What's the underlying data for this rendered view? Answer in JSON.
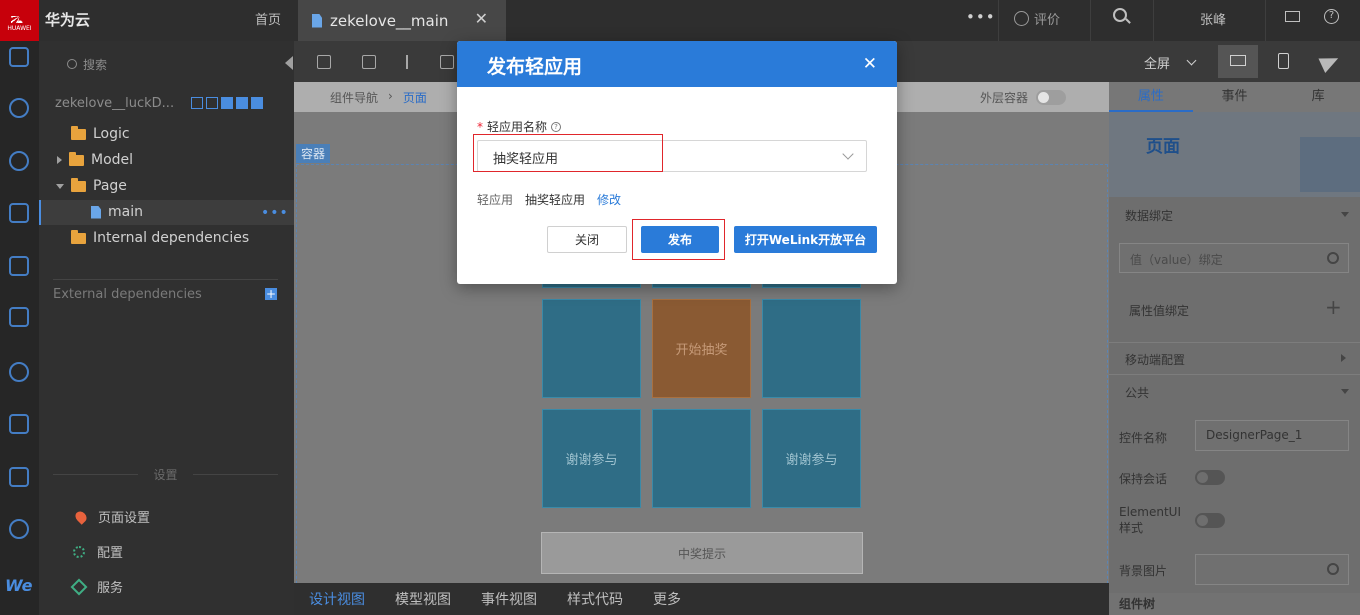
{
  "topbar": {
    "logo_text": "HUAWEI",
    "brand": "华为云",
    "home": "首页",
    "tab_title": "zekelove__main",
    "tab_close": "✕",
    "more": "•••",
    "rate": "评价",
    "user": "张峰",
    "help": "?"
  },
  "left_panel": {
    "search_placeholder": "搜索",
    "project_name": "zekelove__luckD...",
    "tree": [
      {
        "label": "Logic"
      },
      {
        "label": "Model"
      },
      {
        "label": "Page"
      },
      {
        "label": "main"
      },
      {
        "label": "Internal dependencies"
      }
    ],
    "row_menu": "•••",
    "external_dependencies": "External dependencies",
    "add": "+",
    "settings_title": "设置",
    "settings": [
      {
        "label": "页面设置"
      },
      {
        "label": "配置"
      },
      {
        "label": "服务"
      }
    ],
    "rail_we": "We"
  },
  "toolbar": {
    "fullscreen": "全屏"
  },
  "canvas": {
    "breadcrumb": [
      "组件导航",
      "›",
      "页面"
    ],
    "outer_container": "外层容器",
    "container_tag": "容器",
    "cells": [
      {
        "label": ""
      },
      {
        "label": "开始抽奖"
      },
      {
        "label": ""
      },
      {
        "label": "谢谢参与"
      },
      {
        "label": ""
      },
      {
        "label": "谢谢参与"
      }
    ],
    "prize_tip": "中奖提示"
  },
  "view_tabs": [
    "设计视图",
    "模型视图",
    "事件视图",
    "样式代码",
    "更多"
  ],
  "right_panel": {
    "tabs": [
      "属性",
      "事件",
      "库"
    ],
    "hero_title": "页面",
    "data_binding": "数据绑定",
    "value_binding_placeholder": "值（value）绑定",
    "prop_binding": "属性值绑定",
    "mobile_config": "移动端配置",
    "common": "公共",
    "control_name_label": "控件名称",
    "control_name_value": "DesignerPage_1",
    "keep_session": "保持会话",
    "element_ui_style": "ElementUI样式",
    "bg_image": "背景图片",
    "component_tree": "组件树"
  },
  "modal": {
    "title": "发布轻应用",
    "close": "✕",
    "field_required": "*",
    "field_label": "轻应用名称",
    "field_value": "抽奖轻应用",
    "info_prefix": "轻应用",
    "info_value": "抽奖轻应用",
    "info_link": "修改",
    "btn_close": "关闭",
    "btn_publish": "发布",
    "btn_welink": "打开WeLink开放平台"
  },
  "colors": {
    "accent": "#2a7bd9",
    "highlight_box": "#e0262b",
    "start_cell": "#8a5a33",
    "cell": "#2f6d86"
  }
}
